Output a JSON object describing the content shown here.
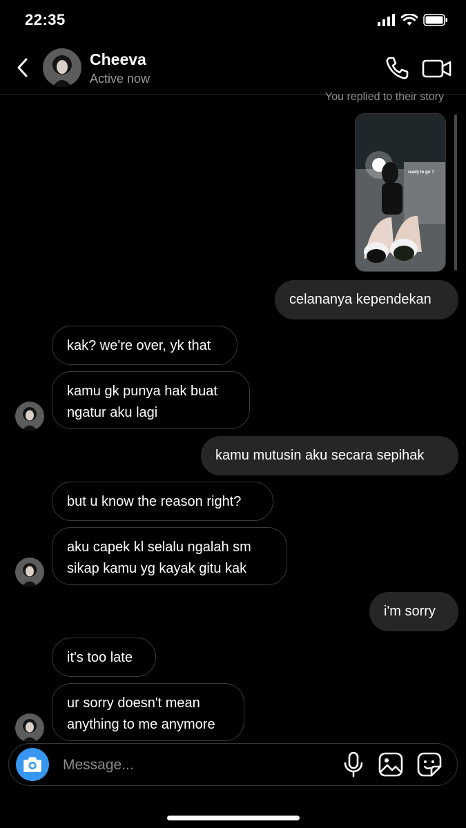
{
  "status_bar": {
    "time": "22:35"
  },
  "header": {
    "name": "Cheeva",
    "status": "Active now"
  },
  "story_reply": {
    "caption": "You replied to their story",
    "story_text": "ready to go ?"
  },
  "messages": [
    {
      "sender": "me",
      "lines": [
        "celananya kependekan"
      ]
    },
    {
      "sender": "them",
      "lines": [
        "kak? we're over, yk that"
      ]
    },
    {
      "sender": "them",
      "lines": [
        "kamu gk punya hak buat",
        "ngatur aku lagi"
      ]
    },
    {
      "sender": "me",
      "lines": [
        "kamu mutusin aku secara sepihak"
      ]
    },
    {
      "sender": "them",
      "lines": [
        "but u know the reason right?"
      ]
    },
    {
      "sender": "them",
      "lines": [
        "aku capek kl selalu ngalah sm",
        "sikap kamu yg kayak gitu kak"
      ]
    },
    {
      "sender": "me",
      "lines": [
        "i'm sorry"
      ]
    },
    {
      "sender": "them",
      "lines": [
        "it's too late"
      ]
    },
    {
      "sender": "them",
      "lines": [
        "ur sorry doesn't mean",
        "anything to me anymore"
      ]
    }
  ],
  "composer": {
    "placeholder": "Message..."
  },
  "icons": {
    "back": "chevron-left-icon",
    "call": "phone-icon",
    "video": "video-camera-icon",
    "camera": "camera-icon",
    "mic": "microphone-icon",
    "gallery": "image-icon",
    "sticker": "sticker-icon"
  },
  "colors": {
    "background": "#000000",
    "outgoing_bubble": "#262626",
    "incoming_border": "#3a3a3a",
    "camera_button": "#3797f0",
    "secondary_text": "#8e8e8e"
  }
}
